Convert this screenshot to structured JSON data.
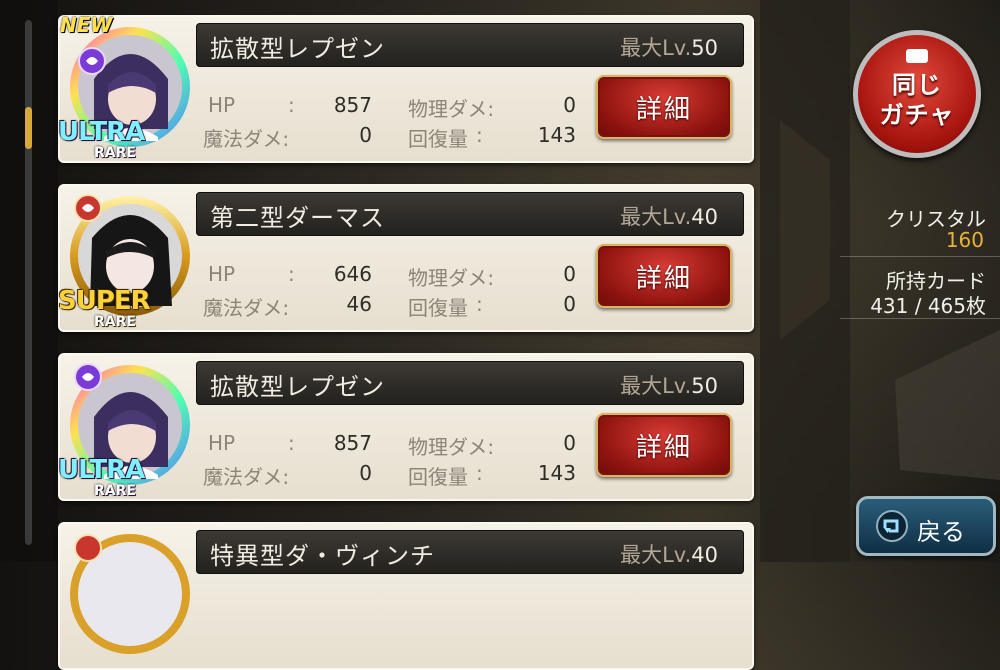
{
  "cards": [
    {
      "name": "拡散型レプゼン",
      "maxlv_label": "最大Lv.",
      "maxlv_value": "50",
      "new_badge": "NEW",
      "rarity_top": "ULTRA",
      "rarity_bottom": "RARE",
      "rarity": "ultra",
      "hp_label": "HP",
      "colon": ":",
      "hp": "857",
      "phys_label": "物理ダメ:",
      "phys": "0",
      "magic_label": "魔法ダメ:",
      "magic": "0",
      "heal_label": "回復量",
      "heal_colon": ":",
      "heal": "143",
      "detail_label": "詳細"
    },
    {
      "name": "第二型ダーマス",
      "maxlv_label": "最大Lv.",
      "maxlv_value": "40",
      "rarity_top": "SUPER",
      "rarity_bottom": "RARE",
      "rarity": "super",
      "hp_label": "HP",
      "colon": ":",
      "hp": "646",
      "phys_label": "物理ダメ:",
      "phys": "0",
      "magic_label": "魔法ダメ:",
      "magic": "46",
      "heal_label": "回復量",
      "heal_colon": ":",
      "heal": "0",
      "detail_label": "詳細"
    },
    {
      "name": "拡散型レプゼン",
      "maxlv_label": "最大Lv.",
      "maxlv_value": "50",
      "rarity_top": "ULTRA",
      "rarity_bottom": "RARE",
      "rarity": "ultra",
      "hp_label": "HP",
      "colon": ":",
      "hp": "857",
      "phys_label": "物理ダメ:",
      "phys": "0",
      "magic_label": "魔法ダメ:",
      "magic": "0",
      "heal_label": "回復量",
      "heal_colon": ":",
      "heal": "143",
      "detail_label": "詳細"
    },
    {
      "name": "特異型ダ・ヴィンチ",
      "maxlv_label": "最大Lv.",
      "maxlv_value": "40"
    }
  ],
  "sidebar": {
    "gacha_line1": "同じ",
    "gacha_line2": "ガチャ",
    "crystal_label": "クリスタル",
    "crystal_value": "160",
    "cards_label": "所持カード",
    "cards_value": "431 / 465枚",
    "back_label": "戻る"
  },
  "colors": {
    "accent_gold": "#e8b23a",
    "detail_red": "#b0201a",
    "back_blue": "#1f4a63"
  },
  "scroll_position": 0.18
}
